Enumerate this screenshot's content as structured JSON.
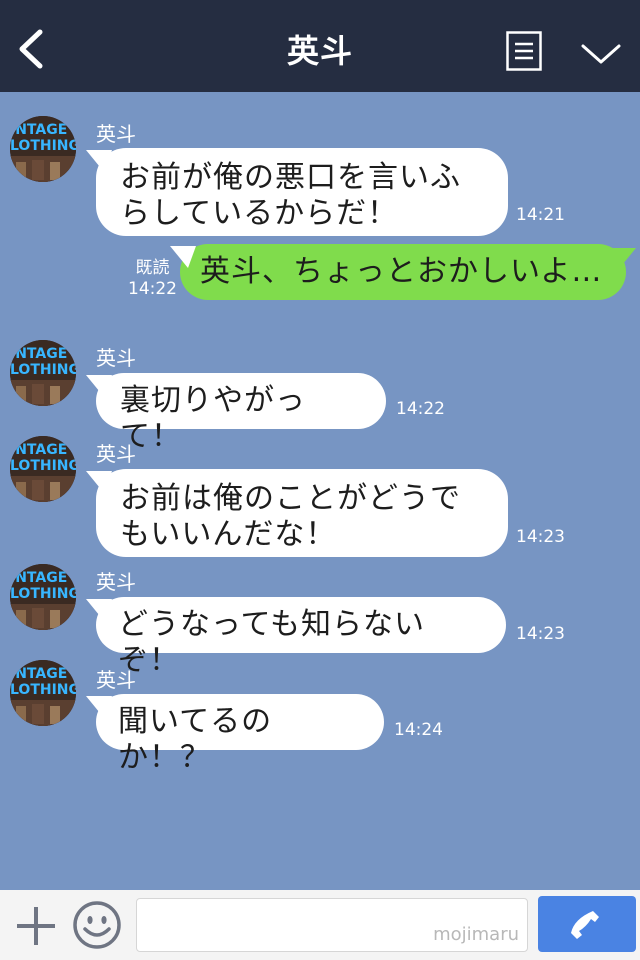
{
  "header": {
    "title": "英斗"
  },
  "messages": [
    {
      "sender": "英斗",
      "text": "お前が俺の悪口を言いふらしているからだ！",
      "time": "14:21"
    },
    {
      "sender": "me",
      "text": "英斗、ちょっとおかしいよ…",
      "read_label": "既読",
      "time": "14:22"
    },
    {
      "sender": "英斗",
      "text": "裏切りやがって！",
      "time": "14:22"
    },
    {
      "sender": "英斗",
      "text": "お前は俺のことがどうでもいいんだな！",
      "time": "14:23"
    },
    {
      "sender": "英斗",
      "text": "どうなっても知らないぞ！",
      "time": "14:23"
    },
    {
      "sender": "英斗",
      "text": "聞いてるのか！？",
      "time": "14:24"
    }
  ],
  "avatar": {
    "line1": "INTAGE",
    "line2": "LOTHING"
  },
  "footer": {
    "watermark": "mojimaru"
  },
  "colors": {
    "header": "#252d41",
    "chat_bg": "#7795c3",
    "sent_bubble": "#80dc4c",
    "call_button": "#4a83e3"
  }
}
